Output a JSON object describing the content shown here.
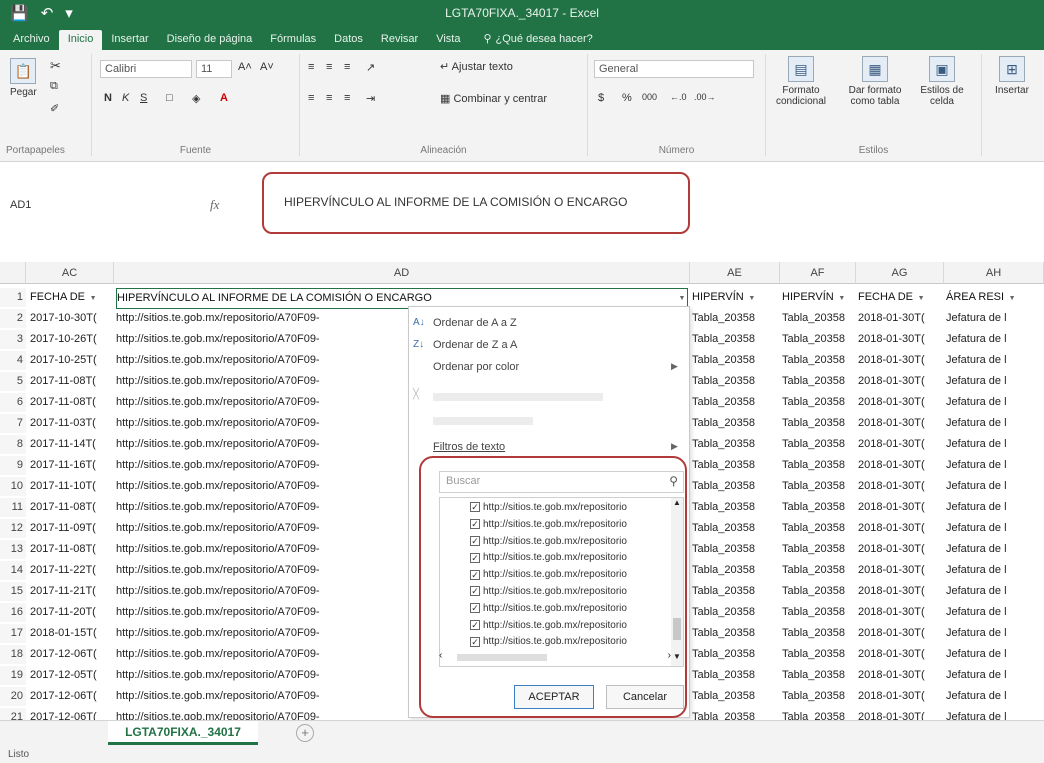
{
  "window": {
    "title": "LGTA70FIXA._34017  -  Excel"
  },
  "menu": {
    "tabs": [
      "Archivo",
      "Inicio",
      "Insertar",
      "Diseño de página",
      "Fórmulas",
      "Datos",
      "Revisar",
      "Vista"
    ],
    "tell_me": "¿Qué desea hacer?"
  },
  "ribbon": {
    "paste": "Pegar",
    "font_name": "Calibri",
    "font_size": "11",
    "bold": "N",
    "italic": "K",
    "underline": "S",
    "wrap_text": "Ajustar texto",
    "merge_center": "Combinar y centrar",
    "number_format": "General",
    "currency": "$",
    "percent": "%",
    "thousands": "000",
    "conditional_format": "Formato condicional",
    "format_as_table": "Dar formato como tabla",
    "cell_styles": "Estilos de celda",
    "insert": "Insertar",
    "groups": {
      "clipboard": "Portapapeles",
      "font": "Fuente",
      "alignment": "Alineación",
      "number": "Número",
      "styles": "Estilos"
    }
  },
  "formula_bar": {
    "name_box": "AD1",
    "fx": "fx",
    "content": "HIPERVÍNCULO AL INFORME DE LA COMISIÓN O ENCARGO"
  },
  "grid": {
    "columns": [
      "AC",
      "AD",
      "AE",
      "AF",
      "AG",
      "AH"
    ],
    "header_row": {
      "ac": "FECHA DE",
      "ad": "HIPERVÍNCULO AL INFORME DE LA COMISIÓN O ENCARGO",
      "ae": "HIPERVÍN",
      "af": "HIPERVÍN",
      "ag": "FECHA DE",
      "ah": "ÁREA RESI"
    },
    "rows": [
      {
        "n": "2",
        "ac": "2017-10-30T(",
        "ad": "http://sitios.te.gob.mx/repositorio/A70F09-",
        "ae": "Tabla_20358",
        "af": "Tabla_20358",
        "ag": "2018-01-30T(",
        "ah": "Jefatura de l"
      },
      {
        "n": "3",
        "ac": "2017-10-26T(",
        "ad": "http://sitios.te.gob.mx/repositorio/A70F09-",
        "ae": "Tabla_20358",
        "af": "Tabla_20358",
        "ag": "2018-01-30T(",
        "ah": "Jefatura de l"
      },
      {
        "n": "4",
        "ac": "2017-10-25T(",
        "ad": "http://sitios.te.gob.mx/repositorio/A70F09-",
        "ae": "Tabla_20358",
        "af": "Tabla_20358",
        "ag": "2018-01-30T(",
        "ah": "Jefatura de l"
      },
      {
        "n": "5",
        "ac": "2017-11-08T(",
        "ad": "http://sitios.te.gob.mx/repositorio/A70F09-",
        "ae": "Tabla_20358",
        "af": "Tabla_20358",
        "ag": "2018-01-30T(",
        "ah": "Jefatura de l"
      },
      {
        "n": "6",
        "ac": "2017-11-08T(",
        "ad": "http://sitios.te.gob.mx/repositorio/A70F09-",
        "ae": "Tabla_20358",
        "af": "Tabla_20358",
        "ag": "2018-01-30T(",
        "ah": "Jefatura de l"
      },
      {
        "n": "7",
        "ac": "2017-11-03T(",
        "ad": "http://sitios.te.gob.mx/repositorio/A70F09-",
        "ae": "Tabla_20358",
        "af": "Tabla_20358",
        "ag": "2018-01-30T(",
        "ah": "Jefatura de l"
      },
      {
        "n": "8",
        "ac": "2017-11-14T(",
        "ad": "http://sitios.te.gob.mx/repositorio/A70F09-",
        "ae": "Tabla_20358",
        "af": "Tabla_20358",
        "ag": "2018-01-30T(",
        "ah": "Jefatura de l"
      },
      {
        "n": "9",
        "ac": "2017-11-16T(",
        "ad": "http://sitios.te.gob.mx/repositorio/A70F09-",
        "ae": "Tabla_20358",
        "af": "Tabla_20358",
        "ag": "2018-01-30T(",
        "ah": "Jefatura de l"
      },
      {
        "n": "10",
        "ac": "2017-11-10T(",
        "ad": "http://sitios.te.gob.mx/repositorio/A70F09-",
        "ae": "Tabla_20358",
        "af": "Tabla_20358",
        "ag": "2018-01-30T(",
        "ah": "Jefatura de l"
      },
      {
        "n": "11",
        "ac": "2017-11-08T(",
        "ad": "http://sitios.te.gob.mx/repositorio/A70F09-",
        "ae": "Tabla_20358",
        "af": "Tabla_20358",
        "ag": "2018-01-30T(",
        "ah": "Jefatura de l"
      },
      {
        "n": "12",
        "ac": "2017-11-09T(",
        "ad": "http://sitios.te.gob.mx/repositorio/A70F09-",
        "ae": "Tabla_20358",
        "af": "Tabla_20358",
        "ag": "2018-01-30T(",
        "ah": "Jefatura de l"
      },
      {
        "n": "13",
        "ac": "2017-11-08T(",
        "ad": "http://sitios.te.gob.mx/repositorio/A70F09-",
        "ae": "Tabla_20358",
        "af": "Tabla_20358",
        "ag": "2018-01-30T(",
        "ah": "Jefatura de l"
      },
      {
        "n": "14",
        "ac": "2017-11-22T(",
        "ad": "http://sitios.te.gob.mx/repositorio/A70F09-",
        "ae": "Tabla_20358",
        "af": "Tabla_20358",
        "ag": "2018-01-30T(",
        "ah": "Jefatura de l"
      },
      {
        "n": "15",
        "ac": "2017-11-21T(",
        "ad": "http://sitios.te.gob.mx/repositorio/A70F09-",
        "ae": "Tabla_20358",
        "af": "Tabla_20358",
        "ag": "2018-01-30T(",
        "ah": "Jefatura de l"
      },
      {
        "n": "16",
        "ac": "2017-11-20T(",
        "ad": "http://sitios.te.gob.mx/repositorio/A70F09-",
        "ae": "Tabla_20358",
        "af": "Tabla_20358",
        "ag": "2018-01-30T(",
        "ah": "Jefatura de l"
      },
      {
        "n": "17",
        "ac": "2018-01-15T(",
        "ad": "http://sitios.te.gob.mx/repositorio/A70F09-",
        "ae": "Tabla_20358",
        "af": "Tabla_20358",
        "ag": "2018-01-30T(",
        "ah": "Jefatura de l"
      },
      {
        "n": "18",
        "ac": "2017-12-06T(",
        "ad": "http://sitios.te.gob.mx/repositorio/A70F09-",
        "ae": "Tabla_20358",
        "af": "Tabla_20358",
        "ag": "2018-01-30T(",
        "ah": "Jefatura de l"
      },
      {
        "n": "19",
        "ac": "2017-12-05T(",
        "ad": "http://sitios.te.gob.mx/repositorio/A70F09-",
        "ae": "Tabla_20358",
        "af": "Tabla_20358",
        "ag": "2018-01-30T(",
        "ah": "Jefatura de l"
      },
      {
        "n": "20",
        "ac": "2017-12-06T(",
        "ad": "http://sitios.te.gob.mx/repositorio/A70F09-",
        "ae": "Tabla_20358",
        "af": "Tabla_20358",
        "ag": "2018-01-30T(",
        "ah": "Jefatura de l"
      },
      {
        "n": "21",
        "ac": "2017-12-06T(",
        "ad": "http://sitios.te.gob.mx/repositorio/A70F09-",
        "ae": "Tabla_20358",
        "af": "Tabla_20358",
        "ag": "2018-01-30T(",
        "ah": "Jefatura de l"
      }
    ]
  },
  "filter_menu": {
    "sort_az": "Ordenar de A a Z",
    "sort_za": "Ordenar de Z a A",
    "sort_color": "Ordenar por color",
    "text_filters": "Filtros de texto",
    "search_placeholder": "Buscar",
    "items": [
      "http://sitios.te.gob.mx/repositorio",
      "http://sitios.te.gob.mx/repositorio",
      "http://sitios.te.gob.mx/repositorio",
      "http://sitios.te.gob.mx/repositorio",
      "http://sitios.te.gob.mx/repositorio",
      "http://sitios.te.gob.mx/repositorio",
      "http://sitios.te.gob.mx/repositorio",
      "http://sitios.te.gob.mx/repositorio",
      "http://sitios.te.gob.mx/repositorio"
    ],
    "ok": "ACEPTAR",
    "cancel": "Cancelar"
  },
  "sheets": {
    "active": "LGTA70FIXA._34017",
    "add": "+"
  },
  "status": {
    "text": "Listo"
  },
  "colors": {
    "excel_green": "#217346",
    "highlight_red": "#b13a3a"
  }
}
